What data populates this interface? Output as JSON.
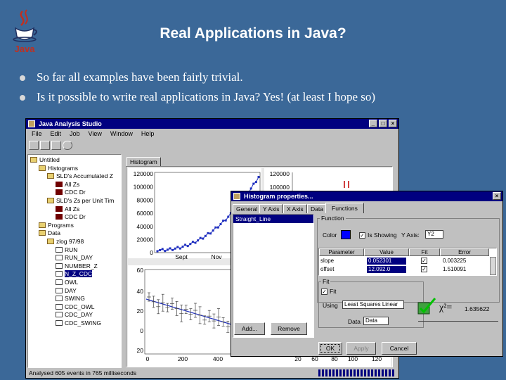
{
  "slide": {
    "title": "Real Applications in Java?",
    "bullets": [
      "So far all examples have been fairly trivial.",
      "Is it possible to write real applications in Java? Yes! (at least I hope so)"
    ],
    "logo_text": "Java"
  },
  "main_window": {
    "title": "Java Analysis Studio",
    "menu": [
      "File",
      "Edit",
      "Job",
      "View",
      "Window",
      "Help"
    ],
    "tree": [
      {
        "label": "Untitled",
        "icon": "folder-icon"
      },
      {
        "label": "Histograms",
        "icon": "folder-icon"
      },
      {
        "label": "SLD's Accumulated Z",
        "icon": "folder-icon"
      },
      {
        "label": "All Zs",
        "icon": "histogram-icon"
      },
      {
        "label": "CDC Dr",
        "icon": "histogram-icon"
      },
      {
        "label": "SLD's Zs per Unit Tim",
        "icon": "folder-icon"
      },
      {
        "label": "All Zs",
        "icon": "histogram-icon"
      },
      {
        "label": "CDC Dr",
        "icon": "histogram-icon"
      },
      {
        "label": "Programs",
        "icon": "folder-icon"
      },
      {
        "label": "Data",
        "icon": "folder-icon"
      },
      {
        "label": "zlog 97/98",
        "icon": "folder-icon"
      },
      {
        "label": "RUN",
        "icon": "leaf-icon"
      },
      {
        "label": "RUN_DAY",
        "icon": "leaf-icon"
      },
      {
        "label": "NUMBER_Z",
        "icon": "leaf-icon"
      },
      {
        "label": "N_Z_CDC",
        "icon": "leaf-icon",
        "selected": true
      },
      {
        "label": "OWL",
        "icon": "leaf-icon"
      },
      {
        "label": "DAY",
        "icon": "leaf-icon"
      },
      {
        "label": "SWING",
        "icon": "leaf-icon"
      },
      {
        "label": "CDC_OWL",
        "icon": "leaf-icon"
      },
      {
        "label": "CDC_DAY",
        "icon": "leaf-icon"
      },
      {
        "label": "CDC_SWING",
        "icon": "leaf-icon"
      }
    ],
    "tab_label": "Histogram",
    "status": "Analysed 605 events in 765 milliseconds",
    "top_plot": {
      "y_ticks": [
        "120000",
        "100000",
        "80000",
        "60000",
        "40000",
        "20000",
        "0"
      ],
      "x_ticks": [
        "Sept",
        "Nov"
      ]
    },
    "right_plot": {
      "y_ticks": [
        "120000",
        "100000"
      ]
    },
    "bottom_plot": {
      "y_ticks": [
        "60",
        "40",
        "20",
        "0",
        "20"
      ],
      "x_ticks": [
        "0",
        "200",
        "400"
      ],
      "right_x_ticks": [
        "20",
        "60",
        "80",
        "100",
        "120"
      ]
    }
  },
  "dialog": {
    "title": "Histogram properties...",
    "tabs": [
      "General",
      "Y Axis",
      "X Axis",
      "Data",
      "Functions"
    ],
    "function_list": [
      "Straight_Line"
    ],
    "function_group_label": "Function",
    "color_label": "Color",
    "is_showing_label": "Is Showing",
    "y_axis_label": "Y Axis:",
    "y_axis_value": "Y2",
    "table_headers": [
      "Parameter",
      "Value",
      "Fit",
      "Error"
    ],
    "table_rows": [
      {
        "parameter": "slope",
        "value": "0.052301",
        "fit": "✓",
        "error": "0.003225"
      },
      {
        "parameter": "offset",
        "value": "12.092.0",
        "fit": "✓",
        "error": "1.510091"
      }
    ],
    "fit_group_label": "Fit",
    "fit_checkbox_label": "Fit",
    "using_label": "Using",
    "using_value": "Least Squares Linear",
    "data_label": "Data",
    "data_value": "Data",
    "chi2_label": "χ²=",
    "chi2_value": "1.635622",
    "buttons": {
      "add": "Add...",
      "remove": "Remove",
      "ok": "OK",
      "apply": "Apply",
      "cancel": "Cancel"
    },
    "accent_color": "#0000ff"
  }
}
